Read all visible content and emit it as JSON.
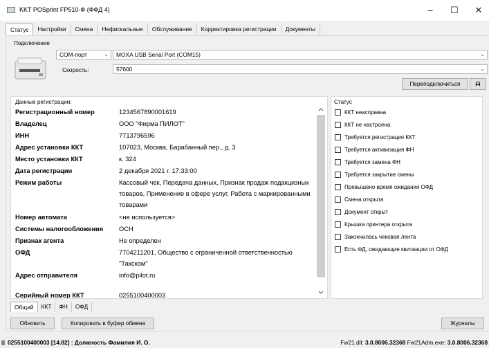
{
  "window": {
    "title": "KKT POSprint FP510-Ф (ФФД 4)",
    "minimize": "–",
    "maximize": "☐",
    "close": "✕"
  },
  "tabs": [
    "Статус",
    "Настройки",
    "Смена",
    "Нефискальные",
    "Обслуживание",
    "Корректировка регистрации",
    "Документы"
  ],
  "connection": {
    "group_label": "Подключение",
    "port_type": "COM-порт",
    "port": "MOXA USB Serial Port (COM15)",
    "speed_label": "Скорость:",
    "speed": "57600",
    "reconnect_button": "Переподключиться",
    "extra_button": "ᗣ"
  },
  "registration": {
    "group_label": "Данные регистрации:",
    "rows": [
      {
        "key": "Регистрационный номер",
        "value": "1234567890001619"
      },
      {
        "key": "Владелец",
        "value": "ООО \"Фирма ПИЛОТ\""
      },
      {
        "key": "ИНН",
        "value": "7713796596"
      },
      {
        "key": "Адрес установки ККТ",
        "value": "107023, Москва, Барабанный пер., д. 3"
      },
      {
        "key": "Место установки ККТ",
        "value": "к. 324"
      },
      {
        "key": "Дата регистрации",
        "value": "2 декабря 2021 г. 17:33:00"
      },
      {
        "key": "Режим работы",
        "value": "Кассовый чек, Передача данных, Признак продаж подакцизных товаров, Применение в сфере услуг, Работа с маркированными товарами"
      },
      {
        "key": "Номер автомата",
        "value": "<не используется>"
      },
      {
        "key": "Системы налогообложения",
        "value": "ОСН"
      },
      {
        "key": "Признак агента",
        "value": "Не определен"
      },
      {
        "key": "ОФД",
        "value": "7704211201, Общество с ограниченной ответственностью \"Такском\""
      },
      {
        "key": "Адрес отправителя",
        "value": "info@pilot.ru"
      },
      {
        "key": "Серийный номер ККТ",
        "value": "0255100400003"
      }
    ]
  },
  "status": {
    "group_label": "Статус",
    "items": [
      "ККТ неисправна",
      "ККТ не настроена",
      "Требуется регистрация ККТ",
      "Требуется активизация ФН",
      "Требуется замена ФН",
      "Требуется закрытие смены",
      "Превышено время ожидания ОФД",
      "Смена открыта",
      "Документ открыт",
      "Крышка принтера открыта",
      "Закончилась чековая лента",
      "Есть ФД, ожидающие квитанции от ОФД"
    ]
  },
  "bottom_tabs": [
    "Общий",
    "ККТ",
    "ФН",
    "ОФД"
  ],
  "buttons": {
    "refresh": "Обновить",
    "copy": "Копировать в буфер обмена",
    "journals": "Журналы"
  },
  "statusbar": {
    "left": "0255100400003 [14.82] : Должность Фамилия И. О.",
    "right_prefix1": "Fw21.dll: ",
    "right_value1": "3.0.8006.32368",
    "right_prefix2": "  Fw21Adm.exe: ",
    "right_value2": "3.0.8006.32368"
  }
}
